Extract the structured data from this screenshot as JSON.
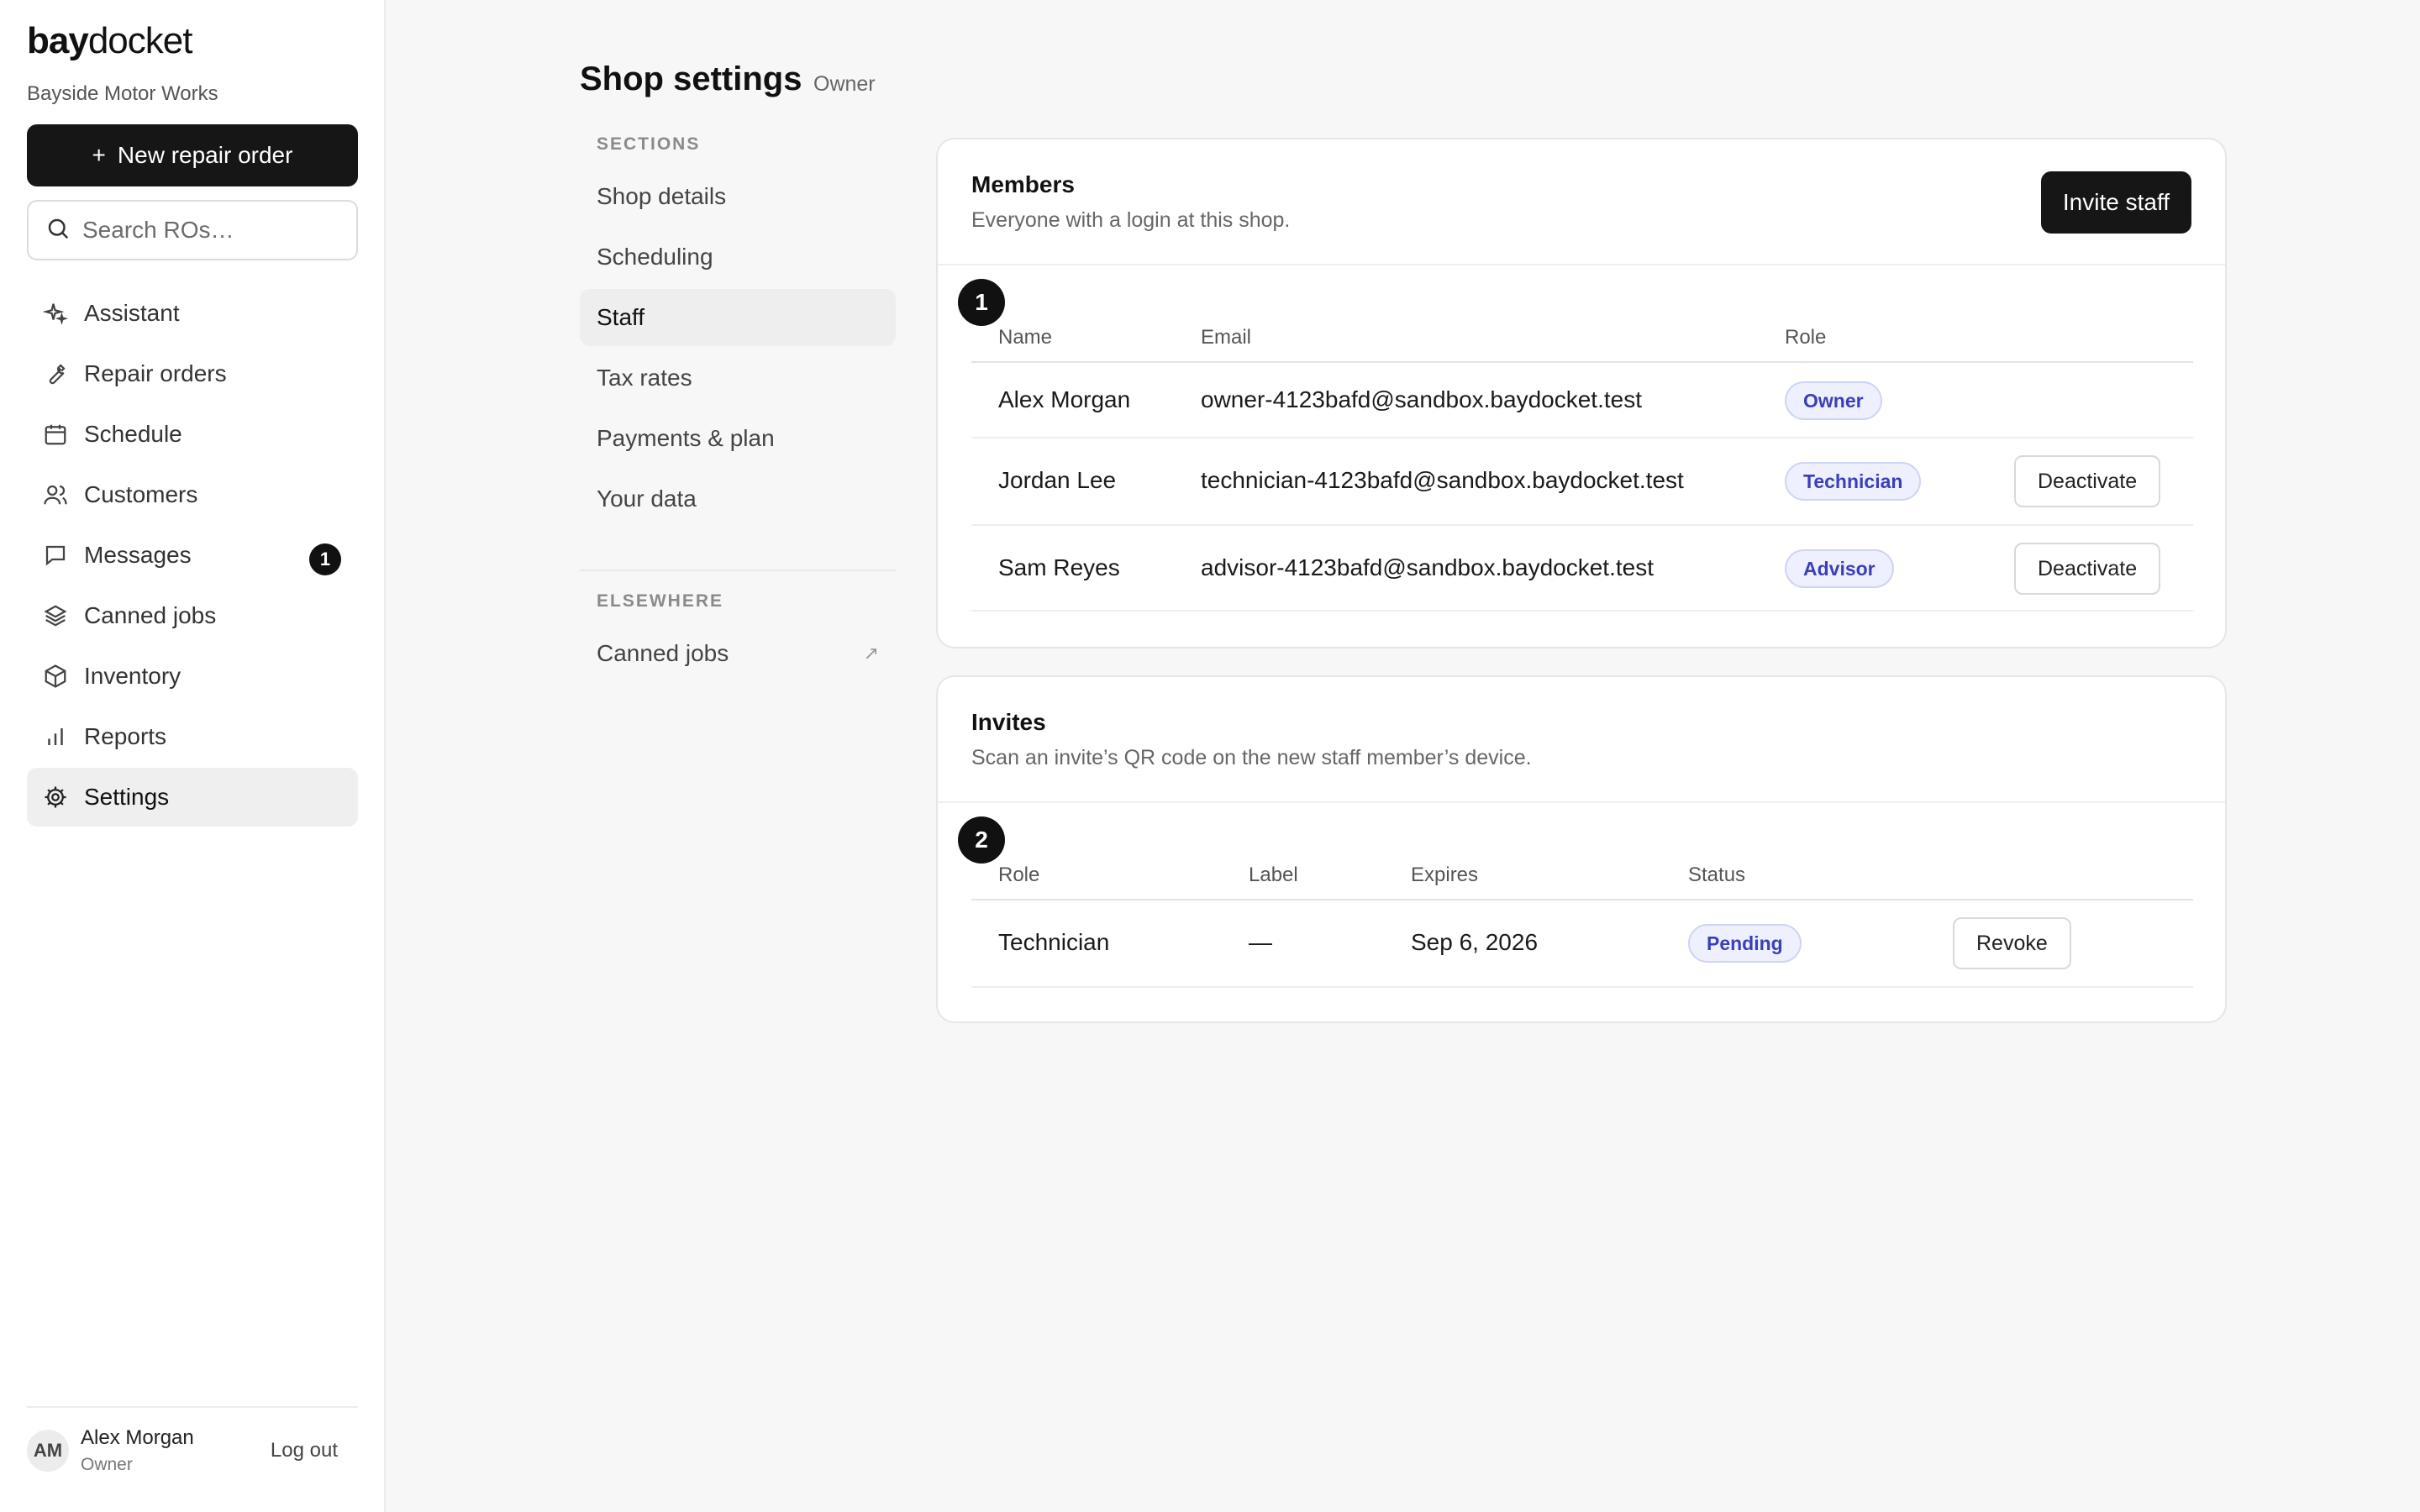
{
  "brand": {
    "logo_bold": "bay",
    "logo_light": "docket",
    "shop_name": "Bayside Motor Works"
  },
  "sidebar": {
    "new_button": {
      "icon": "+",
      "label": "New repair order"
    },
    "search": {
      "placeholder": "Search ROs…"
    },
    "items": [
      {
        "label": "Assistant",
        "icon": "sparkle-icon"
      },
      {
        "label": "Repair orders",
        "icon": "wrench-icon"
      },
      {
        "label": "Schedule",
        "icon": "calendar-icon"
      },
      {
        "label": "Customers",
        "icon": "users-icon"
      },
      {
        "label": "Messages",
        "icon": "message-icon",
        "badge": "1"
      },
      {
        "label": "Canned jobs",
        "icon": "layers-icon"
      },
      {
        "label": "Inventory",
        "icon": "box-icon"
      },
      {
        "label": "Reports",
        "icon": "bar-chart-icon"
      },
      {
        "label": "Settings",
        "icon": "gear-icon",
        "active": true
      }
    ],
    "user": {
      "initials": "AM",
      "name": "Alex Morgan",
      "role": "Owner",
      "logout": "Log out"
    }
  },
  "page": {
    "title": "Shop settings",
    "role": "Owner"
  },
  "subnav": {
    "sections_heading": "SECTIONS",
    "sections": [
      "Shop details",
      "Scheduling",
      "Staff",
      "Tax rates",
      "Payments & plan",
      "Your data"
    ],
    "active": "Staff",
    "elsewhere_heading": "ELSEWHERE",
    "elsewhere": [
      {
        "label": "Canned jobs",
        "arrow": "↗"
      }
    ]
  },
  "members": {
    "marker": "1",
    "title": "Members",
    "subtitle": "Everyone with a login at this shop.",
    "invite_button": "Invite staff",
    "columns": [
      "Name",
      "Email",
      "Role"
    ],
    "rows": [
      {
        "name": "Alex Morgan",
        "email": "owner-4123bafd@sandbox.baydocket.test",
        "role": "Owner",
        "action": ""
      },
      {
        "name": "Jordan Lee",
        "email": "technician-4123bafd@sandbox.baydocket.test",
        "role": "Technician",
        "action": "Deactivate"
      },
      {
        "name": "Sam Reyes",
        "email": "advisor-4123bafd@sandbox.baydocket.test",
        "role": "Advisor",
        "action": "Deactivate"
      }
    ]
  },
  "invites": {
    "marker": "2",
    "title": "Invites",
    "subtitle": "Scan an invite’s QR code on the new staff member’s device.",
    "columns": [
      "Role",
      "Label",
      "Expires",
      "Status"
    ],
    "rows": [
      {
        "role": "Technician",
        "label": "—",
        "expires": "Sep 6, 2026",
        "status": "Pending",
        "action": "Revoke"
      }
    ]
  }
}
